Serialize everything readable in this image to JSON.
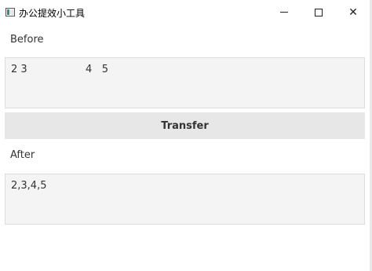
{
  "window": {
    "title": "办公提效小工具",
    "icon": "app-window-icon",
    "controls": {
      "minimize": "minimize-icon",
      "maximize": "maximize-icon",
      "close": "close-icon",
      "close_glyph": "✕"
    }
  },
  "before": {
    "label": "Before",
    "value": "2 3                  4   5"
  },
  "transfer_button": {
    "label": "Transfer"
  },
  "after": {
    "label": "After",
    "value": "2,3,4,5"
  },
  "colors": {
    "accent_icon": "#2f8f83",
    "field_bg": "#f4f4f4",
    "button_bg": "#e7e7e7"
  }
}
